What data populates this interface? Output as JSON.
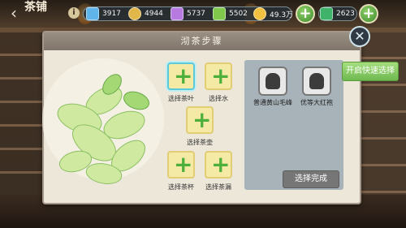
{
  "header": {
    "shop_title": "茶铺",
    "back_icon": "back-arrow-icon",
    "info_icon_text": "i",
    "resources": [
      {
        "name": "blue-gem",
        "value": "3917",
        "color": "#5fb4ea"
      },
      {
        "name": "gold-coin",
        "value": "4944",
        "color": "#e2b74a"
      },
      {
        "name": "purple-crystal",
        "value": "5737",
        "color": "#b77ae0"
      },
      {
        "name": "green-leaf",
        "value": "5502",
        "color": "#7fc84c"
      },
      {
        "name": "coin",
        "value": "49.3万",
        "color": "#f0c040"
      },
      {
        "name": "jade",
        "value": "2623",
        "color": "#3fb36a"
      }
    ]
  },
  "panel": {
    "title": "沏茶步骤",
    "slots": [
      {
        "label": "选择茶叶",
        "active": true
      },
      {
        "label": "选择水",
        "active": false
      },
      {
        "label": "选择茶壶",
        "active": false
      },
      {
        "label": "选择茶杯",
        "active": false
      },
      {
        "label": "选择茶漏",
        "active": false
      }
    ],
    "teas": [
      {
        "name": "普通黄山毛峰"
      },
      {
        "name": "优等大红袍"
      }
    ],
    "done_label": "选择完成",
    "quick_select_label": "开启快速选择"
  },
  "colors": {
    "panel_bg": "#ede7d9",
    "slot_bg": "#f5e9a6",
    "active_border": "#5cc9d8",
    "quick_btn": "#8ed06a",
    "done_btn": "#767676"
  }
}
